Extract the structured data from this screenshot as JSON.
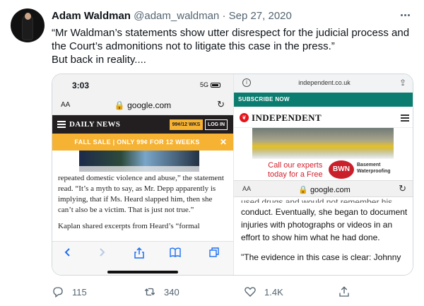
{
  "tweet": {
    "name": "Adam Waldman",
    "handle": "@adam_waldman",
    "separator": "·",
    "date": "Sep 27, 2020",
    "text_line1": "“Mr Waldman’s statements show utter disrespect for the judicial process and the Court’s admonitions not to litigate this case in the press.”",
    "text_line2": "But back in reality...."
  },
  "left_screenshot": {
    "status_time": "3:03",
    "status_signal": "5G",
    "url_aa": "AA",
    "url": "google.com",
    "dn_logo": "DAILY NEWS",
    "dn_subscribe": "99¢/12 WKS",
    "dn_login": "LOG IN",
    "sale_text": "FALL SALE | ONLY 99¢ FOR 12 WEEKS",
    "sale_close": "✕",
    "paragraph1": "repeated domestic violence and abuse,” the statement read. “It’s a myth to say, as Mr. Depp apparently is implying, that if Ms. Heard slapped him, then she can’t also be a victim. That is just not true.”",
    "paragraph2": "Kaplan shared excerpts from Heard’s “formal"
  },
  "right_screenshot": {
    "domain": "independent.co.uk",
    "subscribe": "SUBSCRIBE NOW",
    "logo": "INDEPENDENT",
    "ad_cta_line1": "Call our experts",
    "ad_cta_line2": "today for a Free",
    "ad_brand": "BWN",
    "ad_tag_line1": "Basement",
    "ad_tag_line2": "Waterproofing",
    "url_aa": "AA",
    "url": "google.com",
    "cut_text": "used drugs and would not remember his",
    "paragraph1": "conduct. Eventually, she began to document injuries with photographs or videos in an effort to show him what he had done.",
    "paragraph2": "\"The evidence in this case is clear: Johnny"
  },
  "actions": {
    "reply_count": "115",
    "retweet_count": "340",
    "like_count": "1.4K"
  },
  "colors": {
    "text_primary": "#0f1419",
    "text_secondary": "#536471",
    "daily_news_yellow": "#f6b232",
    "independent_teal": "#0a7d70",
    "independent_red": "#e5131a"
  }
}
